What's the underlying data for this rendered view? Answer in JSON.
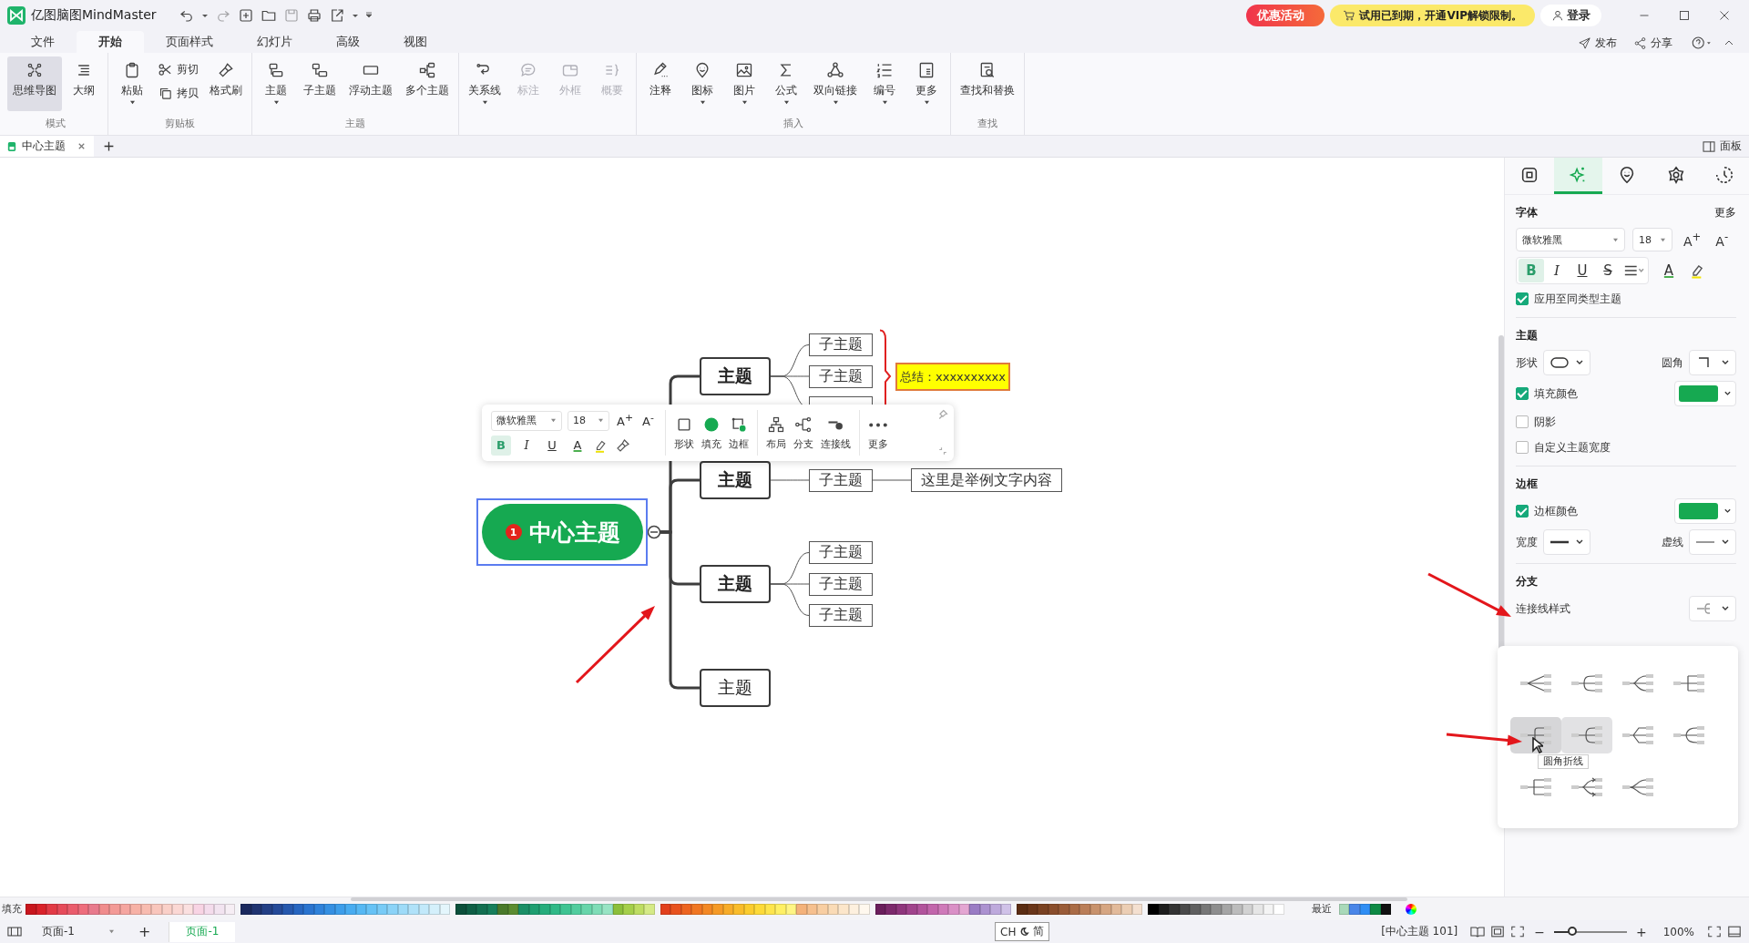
{
  "app": {
    "title": "亿图脑图MindMaster"
  },
  "title_bar": {
    "promo": "优惠活动",
    "vip_notice": "试用已到期，开通VIP解锁限制。",
    "login": "登录"
  },
  "menu_tabs": [
    {
      "label": "文件",
      "selected": false
    },
    {
      "label": "开始",
      "selected": true
    },
    {
      "label": "页面样式",
      "selected": false
    },
    {
      "label": "幻灯片",
      "selected": false
    },
    {
      "label": "高级",
      "selected": false
    },
    {
      "label": "视图",
      "selected": false
    }
  ],
  "menu_actions": [
    {
      "label": "发布"
    },
    {
      "label": "分享"
    }
  ],
  "ribbon": [
    {
      "label": "模式",
      "items": [
        {
          "label": "思维导图",
          "kind": "large",
          "dropdown": false,
          "disabled": false,
          "selected": true
        },
        {
          "label": "大纲",
          "kind": "large",
          "dropdown": false,
          "disabled": false,
          "selected": false
        }
      ]
    },
    {
      "label": "剪贴板",
      "items": [
        {
          "label": "粘贴",
          "kind": "large",
          "dropdown": true,
          "disabled": false
        },
        {
          "label": "剪切",
          "kind": "small",
          "dropdown": false,
          "disabled": false
        },
        {
          "label": "拷贝",
          "kind": "small",
          "dropdown": false,
          "disabled": false
        },
        {
          "label": "格式刷",
          "kind": "large",
          "dropdown": false,
          "disabled": false
        }
      ]
    },
    {
      "label": "主题",
      "items": [
        {
          "label": "主题",
          "kind": "large",
          "dropdown": true,
          "disabled": false
        },
        {
          "label": "子主题",
          "kind": "large",
          "dropdown": false,
          "disabled": false
        },
        {
          "label": "浮动主题",
          "kind": "large",
          "dropdown": false,
          "disabled": false
        },
        {
          "label": "多个主题",
          "kind": "large",
          "dropdown": false,
          "disabled": false
        }
      ]
    },
    {
      "items": [
        {
          "label": "关系线",
          "kind": "large",
          "dropdown": true,
          "disabled": false
        },
        {
          "label": "标注",
          "kind": "large",
          "dropdown": false,
          "disabled": true
        },
        {
          "label": "外框",
          "kind": "large",
          "dropdown": false,
          "disabled": true
        },
        {
          "label": "概要",
          "kind": "large",
          "dropdown": false,
          "disabled": true
        }
      ]
    },
    {
      "label": "插入",
      "items": [
        {
          "label": "注释",
          "kind": "large",
          "dropdown": false,
          "disabled": false
        },
        {
          "label": "图标",
          "kind": "large",
          "dropdown": true,
          "disabled": false
        },
        {
          "label": "图片",
          "kind": "large",
          "dropdown": true,
          "disabled": false
        },
        {
          "label": "公式",
          "kind": "large",
          "dropdown": true,
          "disabled": false
        },
        {
          "label": "双向链接",
          "kind": "large",
          "dropdown": true,
          "disabled": false
        },
        {
          "label": "编号",
          "kind": "large",
          "dropdown": true,
          "disabled": false
        },
        {
          "label": "更多",
          "kind": "large",
          "dropdown": true,
          "disabled": false
        }
      ]
    },
    {
      "label": "查找",
      "items": [
        {
          "label": "查找和替换",
          "kind": "large",
          "dropdown": false,
          "disabled": false
        }
      ]
    }
  ],
  "doc_tabs": [
    {
      "label": "中心主题",
      "selected": true
    }
  ],
  "panel_toggle": "面板",
  "mindmap": {
    "center": {
      "label": "中心主题",
      "badge": "1",
      "selected": true
    },
    "topics": [
      {
        "label": "主题",
        "bold": true,
        "summary": "总结：xxxxxxxxxx",
        "subtopics": [
          {
            "label": "子主题",
            "covered": false
          },
          {
            "label": "子主题",
            "covered": false
          },
          {
            "covered": true
          }
        ]
      },
      {
        "label": "主题",
        "bold": true,
        "subtopics": [
          {
            "label": "子主题",
            "covered": false,
            "attached_text": "这里是举例文字内容"
          }
        ]
      },
      {
        "label": "主题",
        "bold": true,
        "subtopics": [
          {
            "label": "子主题",
            "covered": false
          },
          {
            "label": "子主题",
            "covered": false
          },
          {
            "label": "子主题",
            "covered": false
          }
        ]
      },
      {
        "label": "主题",
        "bold": false
      }
    ]
  },
  "floating_toolbar": {
    "font": "微软雅黑",
    "size": "18",
    "grow": "A$^{+}$",
    "shrink": "A$^{-}$",
    "styles": [
      {
        "label": "B",
        "on": true
      },
      {
        "label": "I",
        "on": false
      },
      {
        "label": "U",
        "on": false
      }
    ],
    "text_color": "A",
    "tools": [
      {
        "label": "形状"
      },
      {
        "label": "填充"
      },
      {
        "label": "边框"
      },
      {
        "label": "布局"
      },
      {
        "label": "分支"
      },
      {
        "label": "连接线"
      },
      {
        "label": "更多"
      }
    ]
  },
  "side_panel": {
    "tabs": [
      {
        "selected": false
      },
      {
        "selected": true
      },
      {
        "selected": false
      },
      {
        "selected": false
      },
      {
        "selected": false
      }
    ],
    "font": {
      "heading": "字体",
      "more": "更多",
      "family": "微软雅黑",
      "size": "18",
      "grow": "A$^{+}$",
      "shrink": "A$^{-}$",
      "styles": [
        {
          "label": "B",
          "on": true
        },
        {
          "label": "I",
          "on": false
        },
        {
          "label": "U",
          "on": false
        },
        {
          "label": "S",
          "on": false
        }
      ],
      "text_color": "A",
      "apply_same_type": {
        "label": "应用至同类型主题",
        "checked": true
      }
    },
    "topic": {
      "heading": "主题",
      "shape_label": "形状",
      "corner_label": "圆角",
      "fill": {
        "label": "填充颜色",
        "checked": true,
        "color": "#16a951"
      },
      "shadow": {
        "label": "阴影",
        "checked": false
      },
      "custom_width": {
        "label": "自定义主题宽度",
        "checked": false
      }
    },
    "border": {
      "heading": "边框",
      "color": {
        "label": "边框颜色",
        "checked": true,
        "color": "#16a951"
      },
      "width_label": "宽度",
      "dash_label": "虚线"
    },
    "branch": {
      "heading": "分支",
      "connector_label": "连接线样式",
      "tooltip": "圆角折线",
      "options": [
        {
          "selected": false,
          "hovered": false
        },
        {
          "selected": false,
          "hovered": false
        },
        {
          "selected": false,
          "hovered": false
        },
        {
          "selected": false,
          "hovered": false
        },
        {
          "selected": false,
          "hovered": true
        },
        {
          "selected": true,
          "hovered": false
        },
        {
          "selected": false,
          "hovered": false
        },
        {
          "selected": false,
          "hovered": false
        },
        {
          "selected": false,
          "hovered": false
        },
        {
          "selected": false,
          "hovered": false
        },
        {
          "selected": false,
          "hovered": false
        }
      ]
    }
  },
  "palette": {
    "label": "填充",
    "recent_label": "最近",
    "groups": [
      {
        "swatches": [
          {
            "color": "#c8161d"
          },
          {
            "color": "#d9222a"
          },
          {
            "color": "#e23a45"
          },
          {
            "color": "#e64b5a"
          },
          {
            "color": "#ea5c6c"
          },
          {
            "color": "#ee6d7c"
          },
          {
            "color": "#e87a8c"
          },
          {
            "color": "#f08c8c"
          },
          {
            "color": "#f39a96"
          },
          {
            "color": "#f5a6a0"
          },
          {
            "color": "#f7b2a6"
          },
          {
            "color": "#f8bcb0"
          },
          {
            "color": "#f9c6bc"
          },
          {
            "color": "#fad0c8"
          },
          {
            "color": "#fbd8d4"
          },
          {
            "color": "#fbe0e0"
          },
          {
            "color": "#f8d4e4"
          },
          {
            "color": "#f4dcec"
          },
          {
            "color": "#f2e4f0"
          },
          {
            "color": "#f6eef4"
          }
        ]
      },
      {
        "swatches": [
          {
            "color": "#1b2a5e"
          },
          {
            "color": "#203470"
          },
          {
            "color": "#233f85"
          },
          {
            "color": "#254a98"
          },
          {
            "color": "#2658ad"
          },
          {
            "color": "#2766c0"
          },
          {
            "color": "#2a74cf"
          },
          {
            "color": "#2f82da"
          },
          {
            "color": "#3590e2"
          },
          {
            "color": "#3d9eea"
          },
          {
            "color": "#48acf0"
          },
          {
            "color": "#56b8f3"
          },
          {
            "color": "#66c2f5"
          },
          {
            "color": "#78cbf6"
          },
          {
            "color": "#8bd3f7"
          },
          {
            "color": "#9edbf8"
          },
          {
            "color": "#b0e2f9"
          },
          {
            "color": "#c2e9fa"
          },
          {
            "color": "#d4f0fb"
          },
          {
            "color": "#e4f6fc"
          }
        ]
      },
      {
        "swatches": [
          {
            "color": "#0b4f3a"
          },
          {
            "color": "#0f5f45"
          },
          {
            "color": "#136f50"
          },
          {
            "color": "#177f5b"
          },
          {
            "color": "#4a7a2a"
          },
          {
            "color": "#5c8c30"
          },
          {
            "color": "#1b8f66"
          },
          {
            "color": "#1f9f71"
          },
          {
            "color": "#26ad7c"
          },
          {
            "color": "#30b987"
          },
          {
            "color": "#3fc492"
          },
          {
            "color": "#52cd9e"
          },
          {
            "color": "#68d5aa"
          },
          {
            "color": "#7fddb7"
          },
          {
            "color": "#98e4c4"
          },
          {
            "color": "#8cbf3a"
          },
          {
            "color": "#a5cf4a"
          },
          {
            "color": "#bedd62"
          },
          {
            "color": "#d5ea86"
          }
        ]
      },
      {
        "swatches": [
          {
            "color": "#e2401c"
          },
          {
            "color": "#e8521e"
          },
          {
            "color": "#ed6420"
          },
          {
            "color": "#f07622"
          },
          {
            "color": "#f38824"
          },
          {
            "color": "#f59a26"
          },
          {
            "color": "#f7ac28"
          },
          {
            "color": "#f9bc2a"
          },
          {
            "color": "#fbcc2e"
          },
          {
            "color": "#fdda38"
          },
          {
            "color": "#fee54c"
          },
          {
            "color": "#fff064"
          },
          {
            "color": "#fff584"
          },
          {
            "color": "#f4b27a"
          },
          {
            "color": "#f6c08e"
          },
          {
            "color": "#f8cea2"
          },
          {
            "color": "#fadbb6"
          },
          {
            "color": "#fce6ca"
          },
          {
            "color": "#fdf0de"
          },
          {
            "color": "#fff8ee"
          }
        ]
      },
      {
        "swatches": [
          {
            "color": "#6b1f5c"
          },
          {
            "color": "#7d2a6c"
          },
          {
            "color": "#8f367c"
          },
          {
            "color": "#a1448c"
          },
          {
            "color": "#b2549c"
          },
          {
            "color": "#c266ab"
          },
          {
            "color": "#cf7ab9"
          },
          {
            "color": "#da90c6"
          },
          {
            "color": "#e4a6d2"
          },
          {
            "color": "#9a7cc4"
          },
          {
            "color": "#ac92d0"
          },
          {
            "color": "#beaadc"
          },
          {
            "color": "#d0c2e8"
          }
        ]
      },
      {
        "swatches": [
          {
            "color": "#5a2c12"
          },
          {
            "color": "#6a361a"
          },
          {
            "color": "#7a4222"
          },
          {
            "color": "#8a4e2c"
          },
          {
            "color": "#9a5c38"
          },
          {
            "color": "#aa6c46"
          },
          {
            "color": "#ba7e58"
          },
          {
            "color": "#c8926c"
          },
          {
            "color": "#d6a682"
          },
          {
            "color": "#e2ba9a"
          },
          {
            "color": "#ecceb4"
          },
          {
            "color": "#f4e0d0"
          }
        ]
      },
      {
        "swatches": [
          {
            "color": "#000000"
          },
          {
            "color": "#1c1c1c"
          },
          {
            "color": "#333333"
          },
          {
            "color": "#4a4a4a"
          },
          {
            "color": "#606060"
          },
          {
            "color": "#777777"
          },
          {
            "color": "#8e8e8e"
          },
          {
            "color": "#a5a5a5"
          },
          {
            "color": "#bcbcbc"
          },
          {
            "color": "#d2d2d2"
          },
          {
            "color": "#e6e6e6"
          },
          {
            "color": "#f4f4f4"
          },
          {
            "color": "#ffffff"
          }
        ]
      }
    ],
    "recent": [
      {
        "color": "#a9d9b9"
      },
      {
        "color": "#4a86e8"
      },
      {
        "color": "#2f8ef4"
      },
      {
        "color": "#0e8a44"
      },
      {
        "color": "#111111"
      }
    ]
  },
  "status_bar": {
    "page_select": "页面-1",
    "add": "+",
    "pages": [
      {
        "label": "页面-1",
        "selected": true
      }
    ],
    "ime": {
      "lang": "CH",
      "mode": "简"
    },
    "selection": "[中心主题 101]",
    "zoom": {
      "minus": "−",
      "plus": "+",
      "level": 0.25,
      "reading": "100%"
    }
  }
}
